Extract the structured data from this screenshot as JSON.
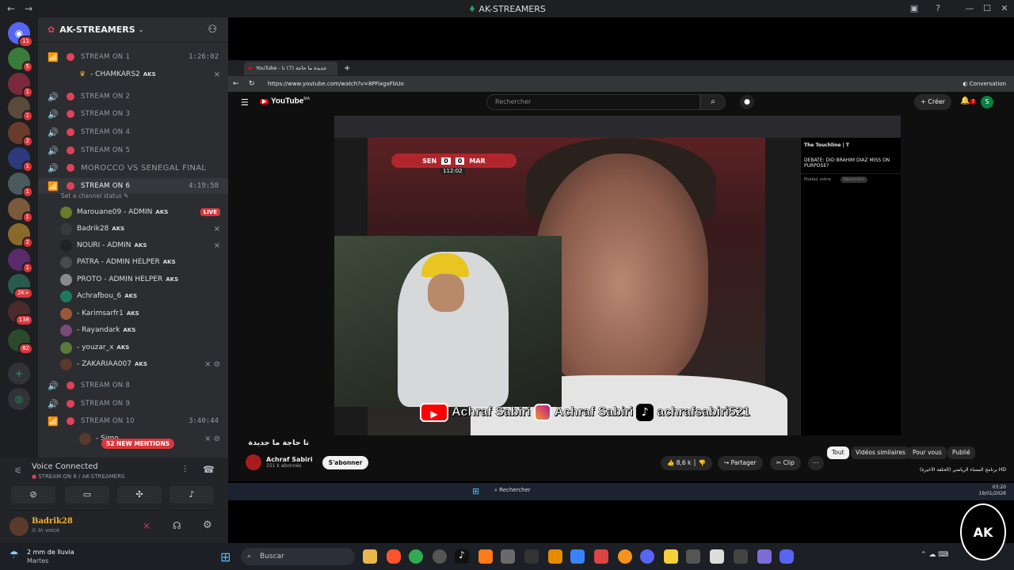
{
  "window": {
    "title": "AK-STREAMERS"
  },
  "server": {
    "name": "AK-STREAMERS",
    "badges": [
      "11",
      "5",
      "1",
      "1",
      "2",
      "1",
      "1",
      "1",
      "2",
      "1",
      "1",
      "2K+",
      "138",
      "82"
    ]
  },
  "channels": [
    {
      "name": "STREAM ON 1",
      "time": "1:26:02"
    },
    {
      "name": "STREAM ON 2"
    },
    {
      "name": "STREAM ON 3"
    },
    {
      "name": "STREAM ON 4"
    },
    {
      "name": "STREAM ON 5"
    },
    {
      "name": "MOROCCO VS SENEGAL FINAL"
    },
    {
      "name": "STREAM ON 6",
      "time": "4:19:58",
      "status": "Set a channel status"
    },
    {
      "name": "STREAM ON 8"
    },
    {
      "name": "STREAM ON 9"
    },
    {
      "name": "STREAM ON 10",
      "time": "3:40:44"
    }
  ],
  "users": {
    "stream1": [
      {
        "name": "- CHAMKARS2",
        "tag": "AKS"
      }
    ],
    "stream6": [
      {
        "name": "Marouane09 - ADMIN",
        "tag": "AKS",
        "live": "LIVE"
      },
      {
        "name": "Badrik28",
        "tag": "AKS"
      },
      {
        "name": "NOURI - ADMIN",
        "tag": "AKS"
      },
      {
        "name": "PATRA - ADMIN HELPER",
        "tag": "AKS"
      },
      {
        "name": "PROTO - ADMIN HELPER",
        "tag": "AKS"
      },
      {
        "name": "Achrafbou_6",
        "tag": "AKS"
      },
      {
        "name": "- Karimsarfr1",
        "tag": "AKS"
      },
      {
        "name": "- Rayandark",
        "tag": "AKS"
      },
      {
        "name": "- youzar_x",
        "tag": "AKS"
      },
      {
        "name": "- ZAKARIAA007",
        "tag": "AKS"
      }
    ],
    "stream10": [
      {
        "name": "- Simo",
        "tag": "AKS"
      }
    ]
  },
  "mentions": "52 NEW MENTIONS",
  "voice": {
    "title": "Voice Connected",
    "channel": "STREAM ON 6 / AK-STREAMERS"
  },
  "me": {
    "name": "Badrik28",
    "status": "In voice"
  },
  "browser": {
    "tab": "YouTube - جديدة ما حاجة (7) تا",
    "url": "https://www.youtube.com/watch?v=8PFixgxFbUo",
    "conversation": "Conversation"
  },
  "youtube": {
    "brand": "YouTube",
    "region": "MA",
    "search_placeholder": "Rechercher",
    "create": "Créer",
    "notif": "7",
    "avatar": "S",
    "video_title": "تا حاجة ما جديدة",
    "channel": "Achraf Sabiri",
    "subs": "151 k abonnés",
    "subscribe": "S'abonner",
    "likes": "8,6 k",
    "share": "Partager",
    "clip": "Clip",
    "chips": [
      "Tout",
      "Vidéos similaires",
      "Pour vous",
      "Publié"
    ],
    "score": {
      "home": "SEN",
      "home_goals": "0",
      "away_goals": "0",
      "away": "MAR",
      "clock": "112:02"
    },
    "banner": {
      "yt": "Achraf Sabiri",
      "ig": "Achraf Sabiri",
      "tk": "achrafsabiri521"
    },
    "tweet": {
      "author": "The Touchline | T",
      "headline": "DEBATE: DID BRAHIM DIAZ MISS ON PURPOSE?",
      "reply_placeholder": "Postez votre",
      "reply_btn": "Répondre"
    },
    "sidebar_video": "HD برنامج المساء الرياضي (الحلقة الأخيرة)"
  },
  "inner_taskbar": {
    "search": "Rechercher",
    "time": "03:20",
    "date": "19/01/2026"
  },
  "taskbar": {
    "weather": "2 mm de lluvia",
    "weather_day": "Martes",
    "search": "Buscar",
    "logo": "AK"
  },
  "colors": {
    "discord_bg": "#2b2d31",
    "live": "#da373c",
    "youtube_red": "#ff0000"
  }
}
